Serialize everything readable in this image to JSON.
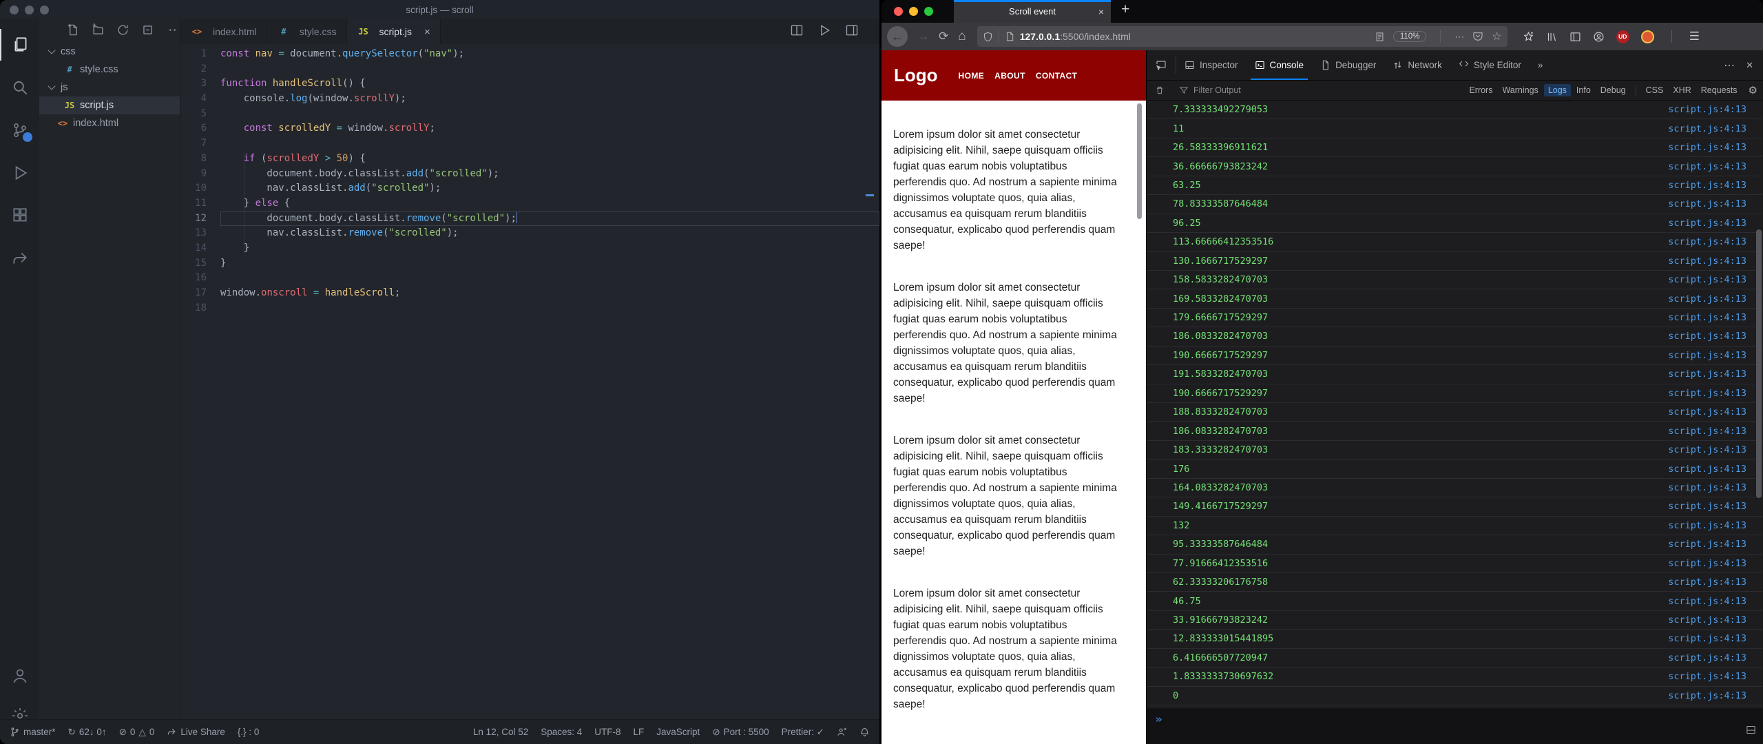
{
  "vscode": {
    "window_title": "script.js — scroll",
    "traffic_color": "#5b616b",
    "explorer": {
      "tree": [
        {
          "label": "css",
          "type": "folder",
          "child": false,
          "selected": false
        },
        {
          "label": "style.css",
          "type": "css",
          "child": true,
          "selected": false
        },
        {
          "label": "js",
          "type": "folder",
          "child": false,
          "selected": false
        },
        {
          "label": "script.js",
          "type": "js",
          "child": true,
          "selected": true
        },
        {
          "label": "index.html",
          "type": "html",
          "child": false,
          "selected": false
        }
      ]
    },
    "file_icons": {
      "css": "#",
      "js": "JS",
      "html": "<>"
    },
    "file_icon_colors": {
      "css": "#519aba",
      "js": "#cbcb41",
      "html": "#e37933"
    },
    "tabs": [
      {
        "label": "index.html",
        "icon": "html",
        "active": false
      },
      {
        "label": "style.css",
        "icon": "css",
        "active": false
      },
      {
        "label": "script.js",
        "icon": "js",
        "active": true
      }
    ],
    "tab_close_glyph": "×",
    "code_lines": [
      {
        "n": 1,
        "tokens": [
          [
            "const",
            "kw"
          ],
          [
            " nav",
            "def"
          ],
          [
            " ",
            "pl"
          ],
          [
            "=",
            "op"
          ],
          [
            " document.",
            "pl"
          ],
          [
            "querySelector",
            "fn"
          ],
          [
            "(",
            "pl"
          ],
          [
            "\"nav\"",
            "str"
          ],
          [
            ");",
            "pl"
          ]
        ]
      },
      {
        "n": 2,
        "tokens": []
      },
      {
        "n": 3,
        "tokens": [
          [
            "function",
            "kw"
          ],
          [
            " handleScroll",
            "def"
          ],
          [
            "() {",
            "pl"
          ]
        ]
      },
      {
        "n": 4,
        "tokens": [
          [
            "    console.",
            "pl"
          ],
          [
            "log",
            "fn"
          ],
          [
            "(window.",
            "pl"
          ],
          [
            "scrollY",
            "var"
          ],
          [
            ");",
            "pl"
          ]
        ]
      },
      {
        "n": 5,
        "tokens": []
      },
      {
        "n": 6,
        "tokens": [
          [
            "    ",
            "pl"
          ],
          [
            "const",
            "kw"
          ],
          [
            " scrolledY",
            "def"
          ],
          [
            " ",
            "pl"
          ],
          [
            "=",
            "op"
          ],
          [
            " window.",
            "pl"
          ],
          [
            "scrollY",
            "var"
          ],
          [
            ";",
            "pl"
          ]
        ]
      },
      {
        "n": 7,
        "tokens": []
      },
      {
        "n": 8,
        "tokens": [
          [
            "    ",
            "pl"
          ],
          [
            "if",
            "kw"
          ],
          [
            " (",
            "pl"
          ],
          [
            "scrolledY",
            "var"
          ],
          [
            " ",
            "pl"
          ],
          [
            ">",
            "op"
          ],
          [
            " ",
            "pl"
          ],
          [
            "50",
            "num"
          ],
          [
            ") {",
            "pl"
          ]
        ]
      },
      {
        "n": 9,
        "tokens": [
          [
            "        document.body.classList.",
            "pl"
          ],
          [
            "add",
            "fn"
          ],
          [
            "(",
            "pl"
          ],
          [
            "\"scrolled\"",
            "str"
          ],
          [
            ");",
            "pl"
          ]
        ]
      },
      {
        "n": 10,
        "tokens": [
          [
            "        nav.classList.",
            "pl"
          ],
          [
            "add",
            "fn"
          ],
          [
            "(",
            "pl"
          ],
          [
            "\"scrolled\"",
            "str"
          ],
          [
            ");",
            "pl"
          ]
        ]
      },
      {
        "n": 11,
        "tokens": [
          [
            "    } ",
            "pl"
          ],
          [
            "else",
            "kw"
          ],
          [
            " {",
            "pl"
          ]
        ]
      },
      {
        "n": 12,
        "cursor": true,
        "tokens": [
          [
            "        document.body.classList.",
            "pl"
          ],
          [
            "remove",
            "fn"
          ],
          [
            "(",
            "pl"
          ],
          [
            "\"scrolled\"",
            "str"
          ],
          [
            ");",
            "pl"
          ]
        ]
      },
      {
        "n": 13,
        "tokens": [
          [
            "        nav.classList.",
            "pl"
          ],
          [
            "remove",
            "fn"
          ],
          [
            "(",
            "pl"
          ],
          [
            "\"scrolled\"",
            "str"
          ],
          [
            ");",
            "pl"
          ]
        ]
      },
      {
        "n": 14,
        "tokens": [
          [
            "    }",
            "pl"
          ]
        ]
      },
      {
        "n": 15,
        "tokens": [
          [
            "}",
            "pl"
          ]
        ]
      },
      {
        "n": 16,
        "tokens": []
      },
      {
        "n": 17,
        "tokens": [
          [
            "window.",
            "pl"
          ],
          [
            "onscroll",
            "var"
          ],
          [
            " ",
            "pl"
          ],
          [
            "=",
            "op"
          ],
          [
            " handleScroll",
            "def"
          ],
          [
            ";",
            "pl"
          ]
        ]
      },
      {
        "n": 18,
        "tokens": []
      }
    ],
    "status": {
      "branch": "master*",
      "sync": "62↓ 0↑",
      "errors": "0",
      "warnings": "0",
      "live_share": "Live Share",
      "braces": "{.} : 0",
      "ln_col": "Ln 12, Col 52",
      "spaces": "Spaces: 4",
      "encoding": "UTF-8",
      "eol": "LF",
      "language": "JavaScript",
      "port": "Port : 5500",
      "prettier": "Prettier: ✓"
    }
  },
  "firefox": {
    "tab_title": "Scroll event",
    "tab_close_glyph": "×",
    "new_tab_glyph": "+",
    "traffic_colors": {
      "red": "#ff5f57",
      "yellow": "#febc2e",
      "green": "#28c840"
    },
    "nav": {
      "back_glyph": "←",
      "forward_glyph": "→",
      "reload_glyph": "⟳",
      "home_glyph": "⌂",
      "url_host": "127.0.0.1",
      "url_rest": ":5500/index.html",
      "zoom_level": "110%",
      "more_glyph": "⋯",
      "star_glyph": "☆",
      "menu_glyph": "☰",
      "ud_badge": "UD"
    },
    "page": {
      "logo": "Logo",
      "nav_links": [
        "HOME",
        "ABOUT",
        "CONTACT"
      ],
      "paragraph": "Lorem ipsum dolor sit amet consectetur adipisicing elit. Nihil, saepe quisquam officiis fugiat quas earum nobis voluptatibus perferendis quo. Ad nostrum a sapiente minima dignissimos voluptate quos, quia alias, accusamus ea quisquam rerum blanditiis consequatur, explicabo quod perferendis quam saepe!",
      "paragraph_count": 4,
      "header_color": "#8e0202"
    },
    "devtools": {
      "tabs": [
        "Inspector",
        "Console",
        "Debugger",
        "Network",
        "Style Editor"
      ],
      "active_tab": "Console",
      "more_tabs_glyph": "»",
      "meatball_glyph": "⋯",
      "close_glyph": "✕",
      "filter_placeholder": "Filter Output",
      "filters_left": [
        "Errors",
        "Warnings",
        "Logs",
        "Info",
        "Debug"
      ],
      "filters_right": [
        "CSS",
        "XHR",
        "Requests"
      ],
      "active_filter": "Logs",
      "gear_glyph": "⚙",
      "prompt_glyph": "»",
      "log_location": "script.js:4:13",
      "log_value_color": "#74e074",
      "log_location_color": "#4d9ae4",
      "log_values": [
        "7.333333492279053",
        "11",
        "26.58333396911621",
        "36.66666793823242",
        "63.25",
        "78.83333587646484",
        "96.25",
        "113.66666412353516",
        "130.1666717529297",
        "158.5833282470703",
        "169.5833282470703",
        "179.6666717529297",
        "186.0833282470703",
        "190.6666717529297",
        "191.5833282470703",
        "190.6666717529297",
        "188.8333282470703",
        "186.0833282470703",
        "183.3333282470703",
        "176",
        "164.0833282470703",
        "149.4166717529297",
        "132",
        "95.33333587646484",
        "77.91666412353516",
        "62.33333206176758",
        "46.75",
        "33.91666793823242",
        "12.833333015441895",
        "6.416666507720947",
        "1.8333333730697632",
        "0"
      ]
    }
  }
}
